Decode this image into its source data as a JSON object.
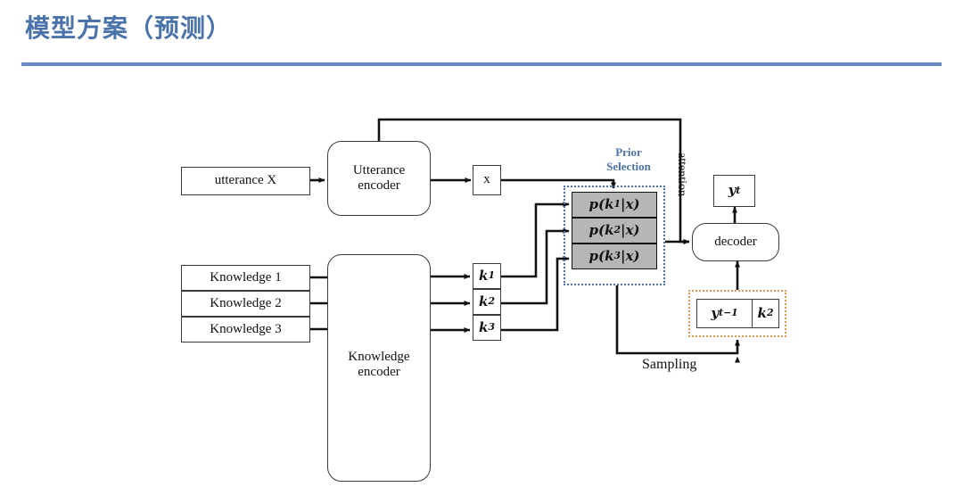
{
  "slide": {
    "title": "模型方案（预测）",
    "accent_color": "#6a8cc7",
    "title_color": "#4a72ab"
  },
  "diagram": {
    "inputs": {
      "utterance_label": "utterance X",
      "knowledge_labels": [
        "Knowledge 1",
        "Knowledge 2",
        "Knowledge 3"
      ]
    },
    "encoders": {
      "utterance_encoder": "Utterance\nencoder",
      "utterance_encoder_line1": "Utterance",
      "utterance_encoder_line2": "encoder",
      "knowledge_encoder_line1": "Knowledge",
      "knowledge_encoder_line2": "encoder"
    },
    "vectors": {
      "x_vector": "x",
      "k_vectors": [
        "k",
        "k",
        "k"
      ],
      "k_subscripts": [
        "1",
        "2",
        "3"
      ]
    },
    "prior_selection": {
      "label_line1": "Prior",
      "label_line2": "Selection",
      "label_color": "#4a72ab",
      "border_color": "#4a72ab",
      "cell_fill": "#b6b6b6",
      "cells": [
        {
          "head": "p(k",
          "sub": "1",
          "tail": "|x)"
        },
        {
          "head": "p(k",
          "sub": "2",
          "tail": "|x)"
        },
        {
          "head": "p(k",
          "sub": "3",
          "tail": "|x)"
        }
      ]
    },
    "decoder": {
      "label": "decoder",
      "output_head": "y",
      "output_sub": "t"
    },
    "decoder_input": {
      "border_color": "#e09a52",
      "prev_token_head": "y",
      "prev_token_sub": "t−1",
      "selected_knowledge_head": "k",
      "selected_knowledge_sub": "2"
    },
    "edges": {
      "attention_label": "attention",
      "sampling_label": "Sampling"
    }
  }
}
